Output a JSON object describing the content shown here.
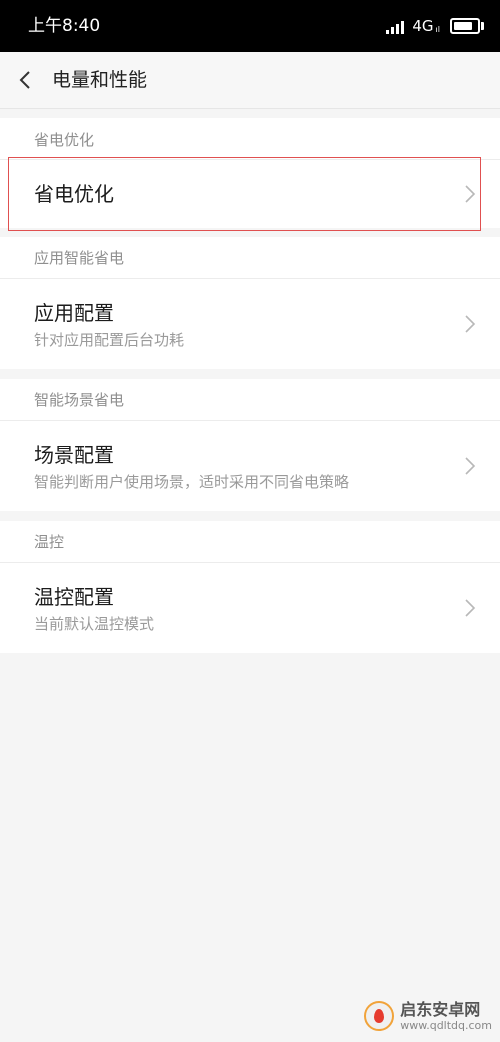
{
  "status_bar": {
    "time": "上午8:40",
    "network": "4G",
    "network_sub": "ıl",
    "battery_level": 0.8
  },
  "header": {
    "title": "电量和性能",
    "back_icon": "chevron-left-icon"
  },
  "sections": [
    {
      "header": "省电优化",
      "items": [
        {
          "title": "省电优化",
          "subtitle": ""
        }
      ]
    },
    {
      "header": "应用智能省电",
      "items": [
        {
          "title": "应用配置",
          "subtitle": "针对应用配置后台功耗"
        }
      ]
    },
    {
      "header": "智能场景省电",
      "items": [
        {
          "title": "场景配置",
          "subtitle": "智能判断用户使用场景，适时采用不同省电策略"
        }
      ]
    },
    {
      "header": "温控",
      "items": [
        {
          "title": "温控配置",
          "subtitle": "当前默认温控模式"
        }
      ]
    }
  ],
  "watermark": {
    "title": "启东安卓网",
    "url": "www.qdltdq.com"
  },
  "colors": {
    "highlight": "#e05050",
    "status_bar_bg": "#000000",
    "page_bg": "#f5f5f5"
  }
}
